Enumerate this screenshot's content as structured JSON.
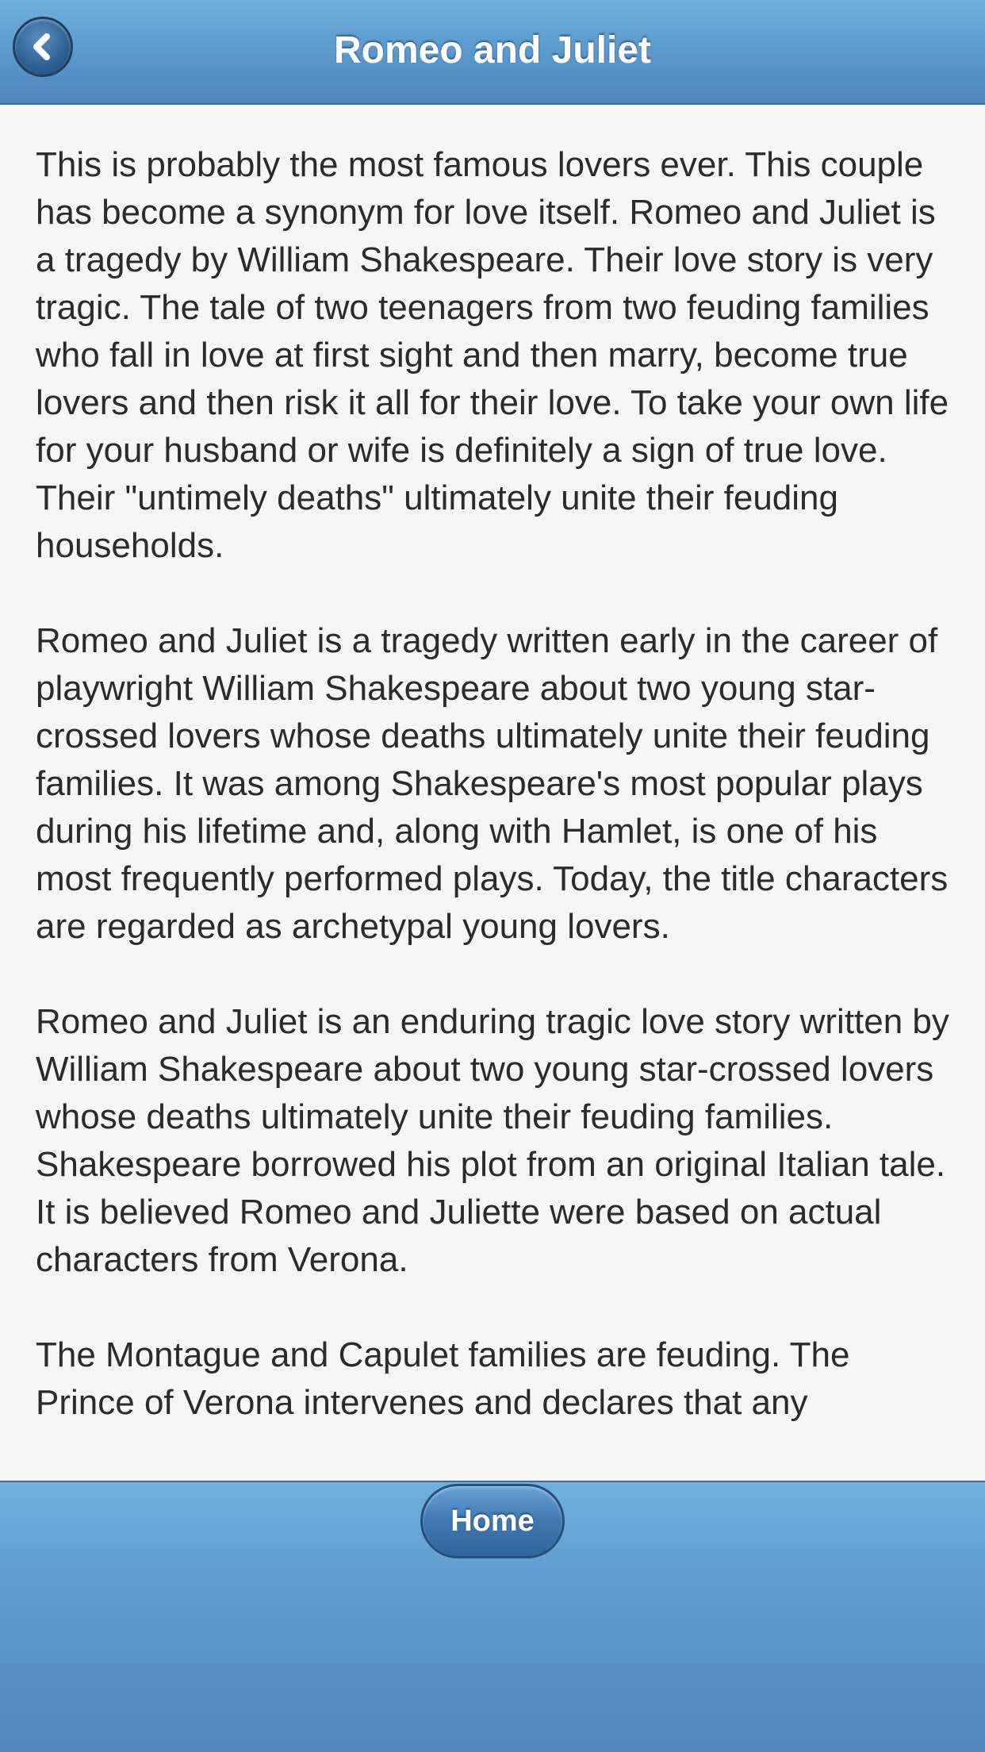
{
  "header": {
    "title": "Romeo and Juliet",
    "back_icon": "chevron-left-icon"
  },
  "article": {
    "paragraphs": [
      "This is probably the most famous lovers ever. This couple has become a synonym for love itself. Romeo and Juliet is a tragedy by William Shakespeare. Their love story is very tragic. The tale of two teenagers from two feuding families who fall in love at first sight and then marry, become true lovers and then risk it all for their love. To take your own life for your husband or wife is definitely a sign of true love. Their \"untimely deaths\" ultimately unite their feuding households.",
      "Romeo and Juliet is a tragedy written early in the career of playwright William Shakespeare about two young star-crossed lovers whose deaths ultimately unite their feuding families. It was among Shakespeare's most popular plays during his lifetime and, along with Hamlet, is one of his most frequently performed plays. Today, the title characters are regarded as archetypal young lovers.",
      "Romeo and Juliet is an enduring tragic love story written by William Shakespeare about two young star-crossed lovers whose deaths ultimately unite their feuding families. Shakespeare borrowed his plot from an original Italian tale. It is believed Romeo and Juliette were based on actual characters from Verona.",
      "The Montague and Capulet families are feuding. The Prince of Verona intervenes and declares that any"
    ]
  },
  "footer": {
    "home_label": "Home"
  }
}
